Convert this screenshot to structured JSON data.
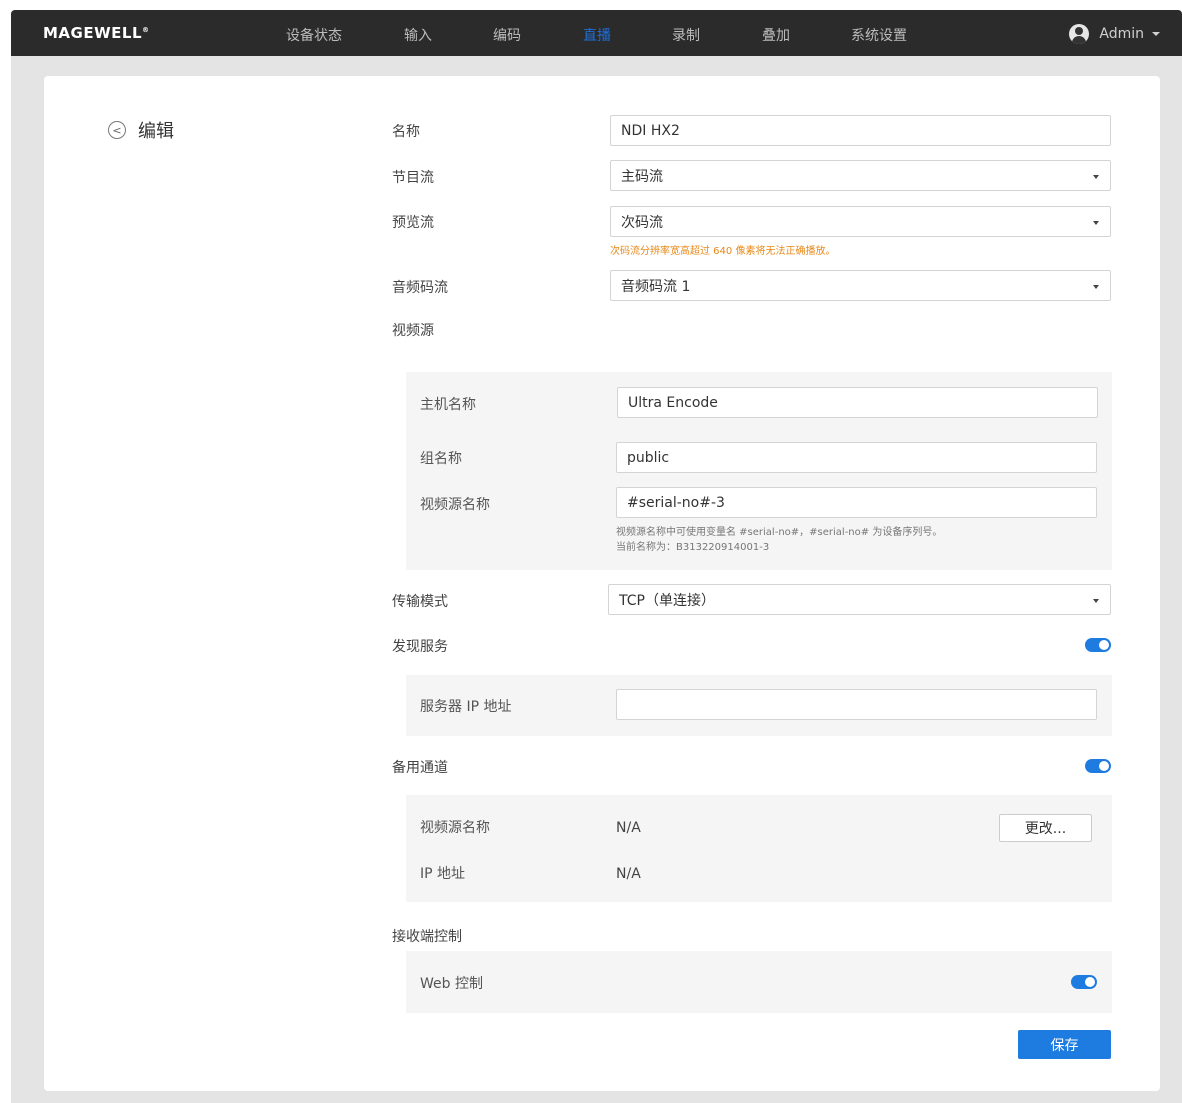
{
  "header": {
    "logo": "MAGEWELL",
    "nav": [
      "设备状态",
      "输入",
      "编码",
      "直播",
      "录制",
      "叠加",
      "系统设置"
    ],
    "active_nav": "直播",
    "user": "Admin"
  },
  "page": {
    "back_label": "编辑"
  },
  "form": {
    "name": {
      "label": "名称",
      "value": "NDI HX2"
    },
    "program_stream": {
      "label": "节目流",
      "value": "主码流"
    },
    "preview_stream": {
      "label": "预览流",
      "value": "次码流",
      "warning": "次码流分辨率宽高超过 640 像素将无法正确播放。"
    },
    "audio_stream": {
      "label": "音频码流",
      "value": "音频码流 1"
    },
    "video_source": {
      "label": "视频源",
      "host_name": {
        "label": "主机名称",
        "value": "Ultra Encode"
      },
      "group_name": {
        "label": "组名称",
        "value": "public"
      },
      "source_name": {
        "label": "视频源名称",
        "value": "#serial-no#-3"
      },
      "hint_line1": "视频源名称中可使用变量名 #serial-no#，#serial-no# 为设备序列号。",
      "hint_line2": "当前名称为：B313220914001-3"
    },
    "transport_mode": {
      "label": "传输模式",
      "value": "TCP（单连接）"
    },
    "discovery": {
      "label": "发现服务",
      "enabled": true,
      "server_ip": {
        "label": "服务器 IP 地址",
        "value": ""
      }
    },
    "backup_channel": {
      "label": "备用通道",
      "enabled": true,
      "source_name_label": "视频源名称",
      "source_name_value": "N/A",
      "ip_label": "IP 地址",
      "ip_value": "N/A",
      "change_button": "更改..."
    },
    "receiver_control": {
      "label": "接收端控制",
      "web_control_label": "Web 控制",
      "web_control_enabled": true
    },
    "save_button": "保存"
  },
  "colors": {
    "accent": "#1e7be0",
    "nav_bg": "#2b2b2b",
    "warning": "#e8891a",
    "panel_bg": "#f5f5f5"
  }
}
